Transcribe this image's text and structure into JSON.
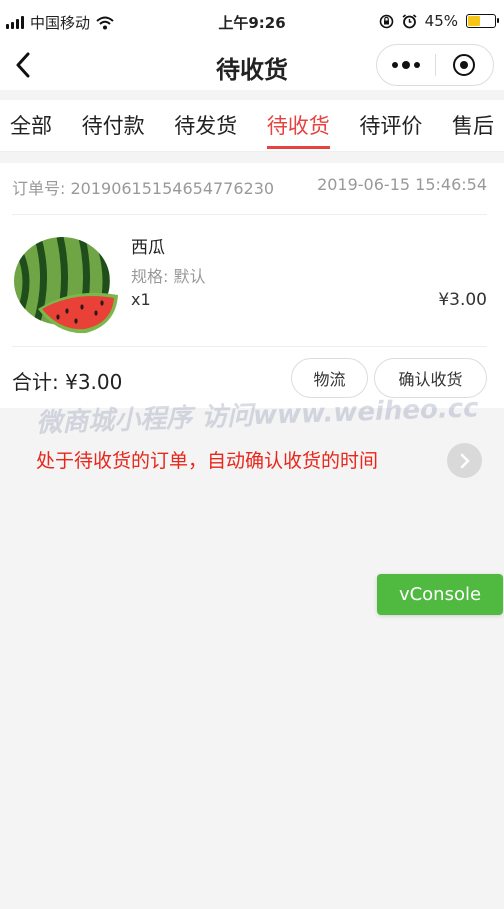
{
  "status_bar": {
    "carrier": "中国移动",
    "time": "上午9:26",
    "battery": "45%",
    "battery_level": 0.45
  },
  "nav": {
    "title": "待收货"
  },
  "tabs": [
    {
      "label": "全部",
      "active": false
    },
    {
      "label": "待付款",
      "active": false
    },
    {
      "label": "待发货",
      "active": false
    },
    {
      "label": "待收货",
      "active": true
    },
    {
      "label": "待评价",
      "active": false
    },
    {
      "label": "售后",
      "active": false
    }
  ],
  "order": {
    "number_label": "订单号: 20190615154654776230",
    "datetime": "2019-06-15 15:46:54",
    "product": {
      "name": "西瓜",
      "spec": "规格: 默认",
      "qty": "x1",
      "price": "¥3.00"
    },
    "total": "合计: ¥3.00",
    "buttons": {
      "logistics": "物流",
      "confirm": "确认收货"
    }
  },
  "watermark": "微商城小程序 访问www.weiheo.cc",
  "annotation": "处于待收货的订单，自动确认收货的时间",
  "vconsole_label": "vConsole",
  "colors": {
    "accent": "#e64340",
    "annotation": "#e8261b",
    "vconsole": "#4fba3f"
  }
}
